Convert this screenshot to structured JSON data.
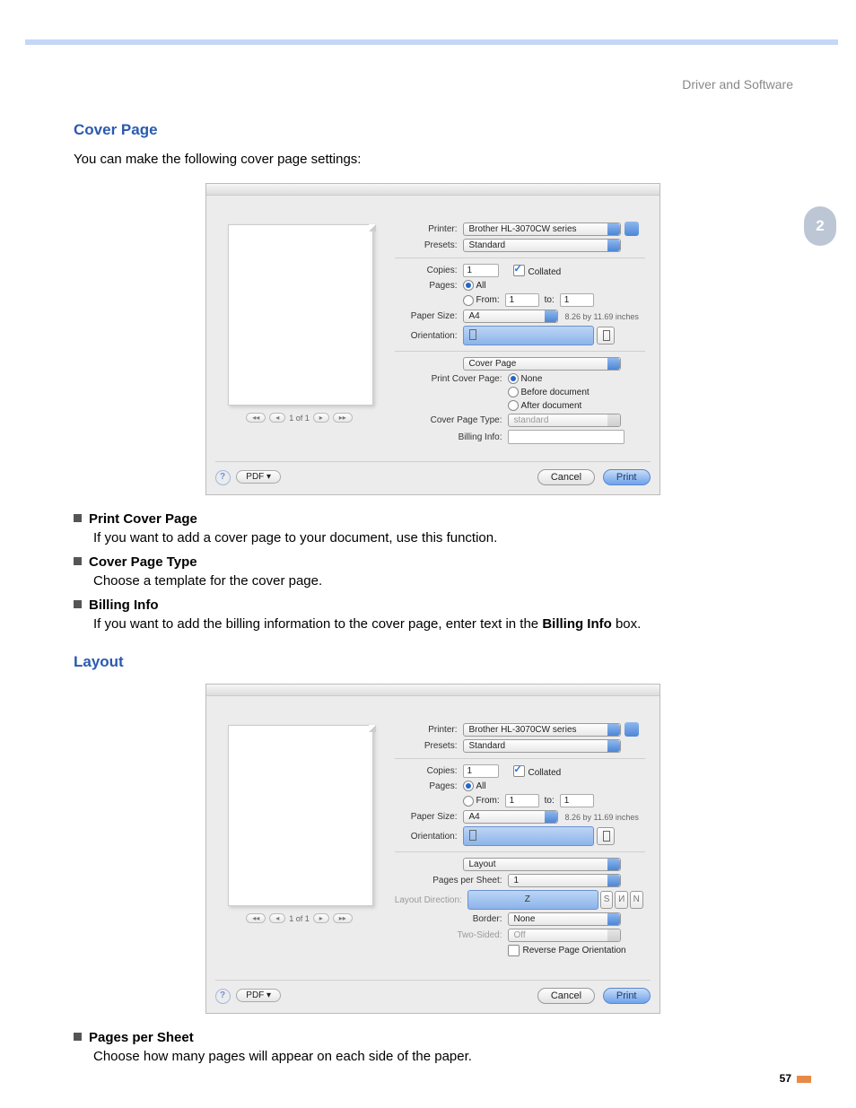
{
  "header": {
    "breadcrumb": "Driver and Software"
  },
  "tab": {
    "label": "2"
  },
  "section1": {
    "title": "Cover Page",
    "lead": "You can make the following cover page settings:"
  },
  "bullets1": [
    {
      "title": "Print Cover Page",
      "desc": "If you want to add a cover page to your document, use this function."
    },
    {
      "title": "Cover Page Type",
      "desc": "Choose a template for the cover page."
    },
    {
      "title": "Billing Info",
      "desc_prefix": "If you want to add the billing information to the cover page, enter text in the ",
      "desc_bold": "Billing Info",
      "desc_suffix": " box."
    }
  ],
  "section2": {
    "title": "Layout"
  },
  "bullets2": [
    {
      "title": "Pages per Sheet",
      "desc": "Choose how many pages will appear on each side of the paper."
    }
  ],
  "common_dialog": {
    "printer_label": "Printer:",
    "printer_value": "Brother HL-3070CW series",
    "presets_label": "Presets:",
    "presets_value": "Standard",
    "copies_label": "Copies:",
    "copies_value": "1",
    "collated_label": "Collated",
    "pages_label": "Pages:",
    "pages_all": "All",
    "pages_from": "From:",
    "pages_from_v": "1",
    "pages_to": "to:",
    "pages_to_v": "1",
    "papersize_label": "Paper Size:",
    "papersize_value": "A4",
    "papersize_note": "8.26 by 11.69 inches",
    "orientation_label": "Orientation:",
    "nav_text": "1 of 1",
    "help": "?",
    "pdf_label": "PDF ▾",
    "cancel": "Cancel",
    "print": "Print"
  },
  "dialog_cover": {
    "panel": "Cover Page",
    "pcp_label": "Print Cover Page:",
    "opt_none": "None",
    "opt_before": "Before document",
    "opt_after": "After document",
    "cpt_label": "Cover Page Type:",
    "cpt_value": "standard",
    "billing_label": "Billing Info:",
    "billing_value": ""
  },
  "dialog_layout": {
    "panel": "Layout",
    "pps_label": "Pages per Sheet:",
    "pps_value": "1",
    "ld_label": "Layout Direction:",
    "border_label": "Border:",
    "border_value": "None",
    "twosided_label": "Two-Sided:",
    "twosided_value": "Off",
    "reverse_label": "Reverse Page Orientation"
  },
  "page_number": "57"
}
